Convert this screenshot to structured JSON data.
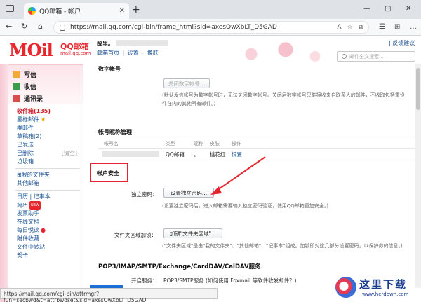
{
  "browser": {
    "tab_title": "QQ邮箱 - 帐户",
    "url": "https://mail.qq.com/cgi-bin/frame_html?sid=axesOwXbLT_D5GAD"
  },
  "header": {
    "logo_text": "MOil",
    "logo_cn": "QQ邮箱",
    "logo_domain": "mail.qq.com",
    "greeting": "故里。",
    "link_home": "邮箱首页",
    "link_sep": "|",
    "link_settings": "设置",
    "link_dash": "-",
    "link_switch": "换肤",
    "feedback": "| 反馈建议",
    "search_placeholder": "邮件全文搜索..."
  },
  "sidebar": {
    "write": "写信",
    "inbox": "收信",
    "contacts": "通讯录",
    "items": [
      {
        "label": "收件箱(135)",
        "style": "bold"
      },
      {
        "label": "星标邮件",
        "star": "★"
      },
      {
        "label": "群邮件"
      },
      {
        "label": "草稿箱(2)"
      },
      {
        "label": "已发送"
      },
      {
        "label": "已删除",
        "extra": "[清空]"
      },
      {
        "label": "垃圾箱"
      }
    ],
    "folders": [
      {
        "label": "我的文件夹"
      },
      {
        "label": "其他邮箱"
      }
    ],
    "apps": [
      {
        "label": "日历 | 记事本"
      },
      {
        "label": "简历",
        "badge": "NEW"
      },
      {
        "label": "发票助手"
      },
      {
        "label": "在线文档"
      },
      {
        "label": "每日悦读",
        "dot": "●"
      },
      {
        "label": "附件收藏"
      },
      {
        "label": "文件中转站"
      },
      {
        "label": "贺卡"
      }
    ]
  },
  "main": {
    "top_section_title": "数字帐号",
    "close_digit_btn": "关闭数字帐号...",
    "top_note_1": "(默认发信帐号为数字帐号时，无法关闭数字帐号。关闭后数字帐号只能接收来自联系人的邮件，不收取包括重设",
    "top_note_2": "件在内的其他所有邮件。)",
    "nickname_title": "帐号昵称管理",
    "table_headers": [
      "帐号名",
      "类型",
      "昵称",
      "皮肤",
      "操作"
    ],
    "table_row": {
      "type": "QQ邮箱",
      "nick": "。",
      "skin": "桃花红",
      "op": "设置"
    },
    "security_title": "帐户安全",
    "pwd_label": "独立密码：",
    "pwd_btn": "设置独立密码...",
    "pwd_note": "(设置独立密码后，进入邮箱需要输入独立密码验证，使用QQ邮箱更加安全。)",
    "folder_lock_label": "文件夹区域加锁：",
    "folder_lock_btn": "加锁\"文件夹区域\"...",
    "folder_lock_note": "(\"文件夹区域\"是由\"我的文件夹\"、\"其他邮箱\"、\"记事本\"组成。加锁即对这几部分设置密码，以保护你的信息。)",
    "pop3_title": "POP3/IMAP/SMTP/Exchange/CardDAV/CalDAV服务",
    "pop3_label": "开启服务：",
    "pop3_row": "POP3/SMTP服务 (如何使用 Foxmail 等软件收发邮件？)"
  },
  "status_url": "https://mail.qq.com/cgi-bin/attrmgr?fun=secpwd&t=attrpwdset&sid=axesOwXbLT_D5GAD",
  "watermark": {
    "text": "这里下载",
    "url": "www.herdown.com"
  },
  "colors": {
    "brand_red": "#e8262d",
    "link_blue": "#1e5494",
    "annotation_red": "#e5252d"
  }
}
